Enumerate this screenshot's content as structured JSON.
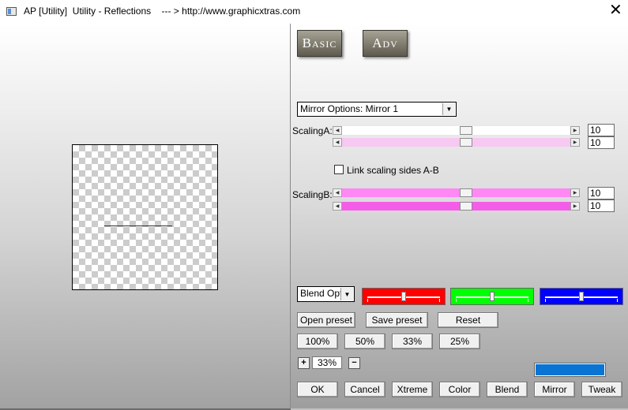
{
  "window": {
    "title": "AP [Utility]  Utility - Reflections    --- > http://www.graphicxtras.com",
    "close_glyph": "✕"
  },
  "mode_buttons": {
    "basic": "Basic",
    "adv": "Adv"
  },
  "mirror_options": {
    "selected": "Mirror Options: Mirror 1"
  },
  "scaling_a": {
    "label": "ScalingA:",
    "slider1_value": "10",
    "slider2_value": "10",
    "track_color_1": "#ffffff",
    "track_color_2": "#f7c8f2"
  },
  "link_checkbox": {
    "label": "Link scaling sides A-B",
    "checked": false
  },
  "scaling_b": {
    "label": "ScalingB:",
    "slider1_value": "10",
    "slider2_value": "10",
    "track_color_1": "#ff88f5",
    "track_color_2": "#f45de8"
  },
  "blend_options": {
    "selected": "Blend Opti"
  },
  "color_sliders": [
    {
      "name": "red",
      "color": "#ff0000"
    },
    {
      "name": "green",
      "color": "#00ff00"
    },
    {
      "name": "blue",
      "color": "#0000ff"
    }
  ],
  "preset_buttons": {
    "open": "Open preset",
    "save": "Save preset",
    "reset": "Reset"
  },
  "zoom_buttons": [
    "100%",
    "50%",
    "33%",
    "25%"
  ],
  "zoom_stepper": {
    "plus": "+",
    "minus": "−",
    "value": "33%"
  },
  "swatch_color": "#0a74d4",
  "action_buttons": {
    "ok": "OK",
    "cancel": "Cancel",
    "xtreme": "Xtreme",
    "color": "Color",
    "blend": "Blend",
    "mirror": "Mirror",
    "tweak": "Tweak"
  },
  "icons": {
    "dropdown_arrow": "▼",
    "arrow_left": "◀",
    "arrow_right": "▶"
  }
}
